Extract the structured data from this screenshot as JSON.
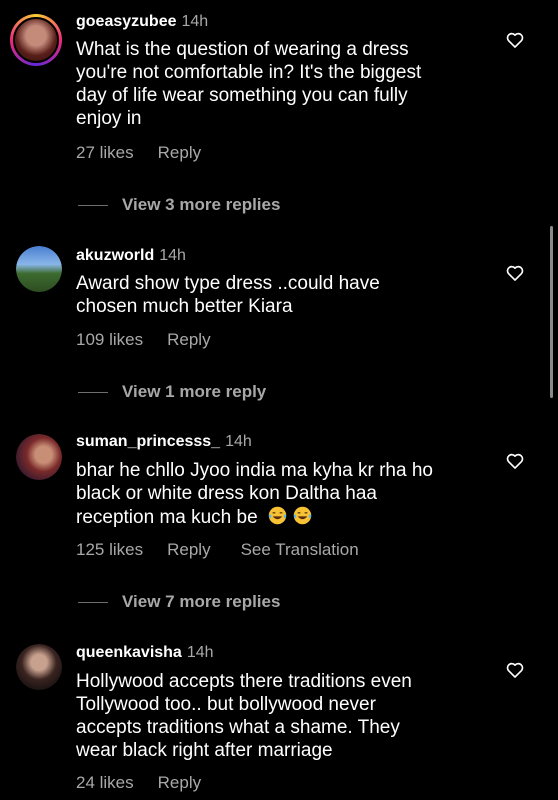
{
  "comments": [
    {
      "username": "goeasyzubee",
      "time": "14h",
      "lines": [
        "What is the question of wearing a dress",
        "you're not comfortable in? It's the biggest",
        "day of life wear something you can fully",
        "enjoy in"
      ],
      "likes": "27 likes",
      "reply": "Reply",
      "view_replies": "View 3 more replies"
    },
    {
      "username": "akuzworld",
      "time": "14h",
      "lines": [
        "Award show type dress ..could have",
        "chosen much better Kiara"
      ],
      "likes": "109 likes",
      "reply": "Reply",
      "view_replies": "View 1 more reply"
    },
    {
      "username": "suman_princesss_",
      "time": "14h",
      "lines": [
        "bhar he chllo Jyoo india ma kyha kr rha ho",
        "black or white dress kon Daltha haa",
        "reception ma kuch be"
      ],
      "emojis": [
        "tears-of-joy",
        "tears-of-joy"
      ],
      "likes": "125 likes",
      "reply": "Reply",
      "see_translation": "See Translation",
      "view_replies": "View 7 more replies"
    },
    {
      "username": "queenkavisha",
      "time": "14h",
      "lines": [
        "Hollywood accepts there traditions even",
        "Tollywood too.. but bollywood never",
        "accepts traditions what a shame. They",
        "wear black right after marriage"
      ],
      "likes": "24 likes",
      "reply": "Reply"
    }
  ],
  "icons": {
    "like": "heart-outline-icon",
    "emoji": "face-with-tears-of-joy"
  },
  "colors": {
    "background": "#000000",
    "primary_text": "#ffffff",
    "secondary_text": "#a8a8a8",
    "story_ring": [
      "#f9ce34",
      "#ee2a7b",
      "#6228d7"
    ]
  }
}
